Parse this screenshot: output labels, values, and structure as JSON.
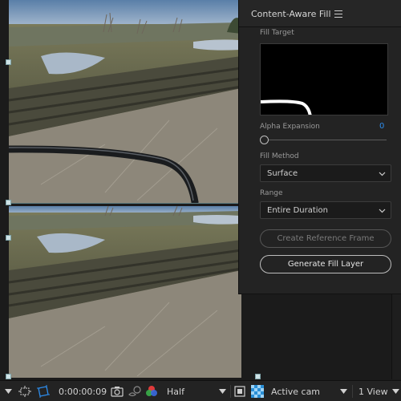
{
  "panel": {
    "title": "Content-Aware Fill",
    "fill_target_label": "Fill Target",
    "alpha_expansion_label": "Alpha Expansion",
    "alpha_expansion_value": "0",
    "alpha_expansion_level": 0,
    "fill_method_label": "Fill Method",
    "fill_method_value": "Surface",
    "range_label": "Range",
    "range_value": "Entire Duration",
    "create_reference_frame_label": "Create Reference Frame",
    "generate_fill_layer_label": "Generate Fill Layer"
  },
  "toolbar": {
    "timecode": "0:00:00:09",
    "resolution": "Half",
    "camera": "Active cam",
    "views": "1 View"
  },
  "colors": {
    "accent_blue": "#2d8ceb",
    "panel_bg": "#232323",
    "viewer_bg": "#1b1b1b"
  },
  "icons": [
    "menu-icon",
    "region-of-interest-icon",
    "transparency-grid-icon",
    "camera-snapshot-icon",
    "show-snapshot-icon",
    "color-channels-icon",
    "chevron-down-icon",
    "fast-previews-icon",
    "toggle-transparency-icon"
  ]
}
